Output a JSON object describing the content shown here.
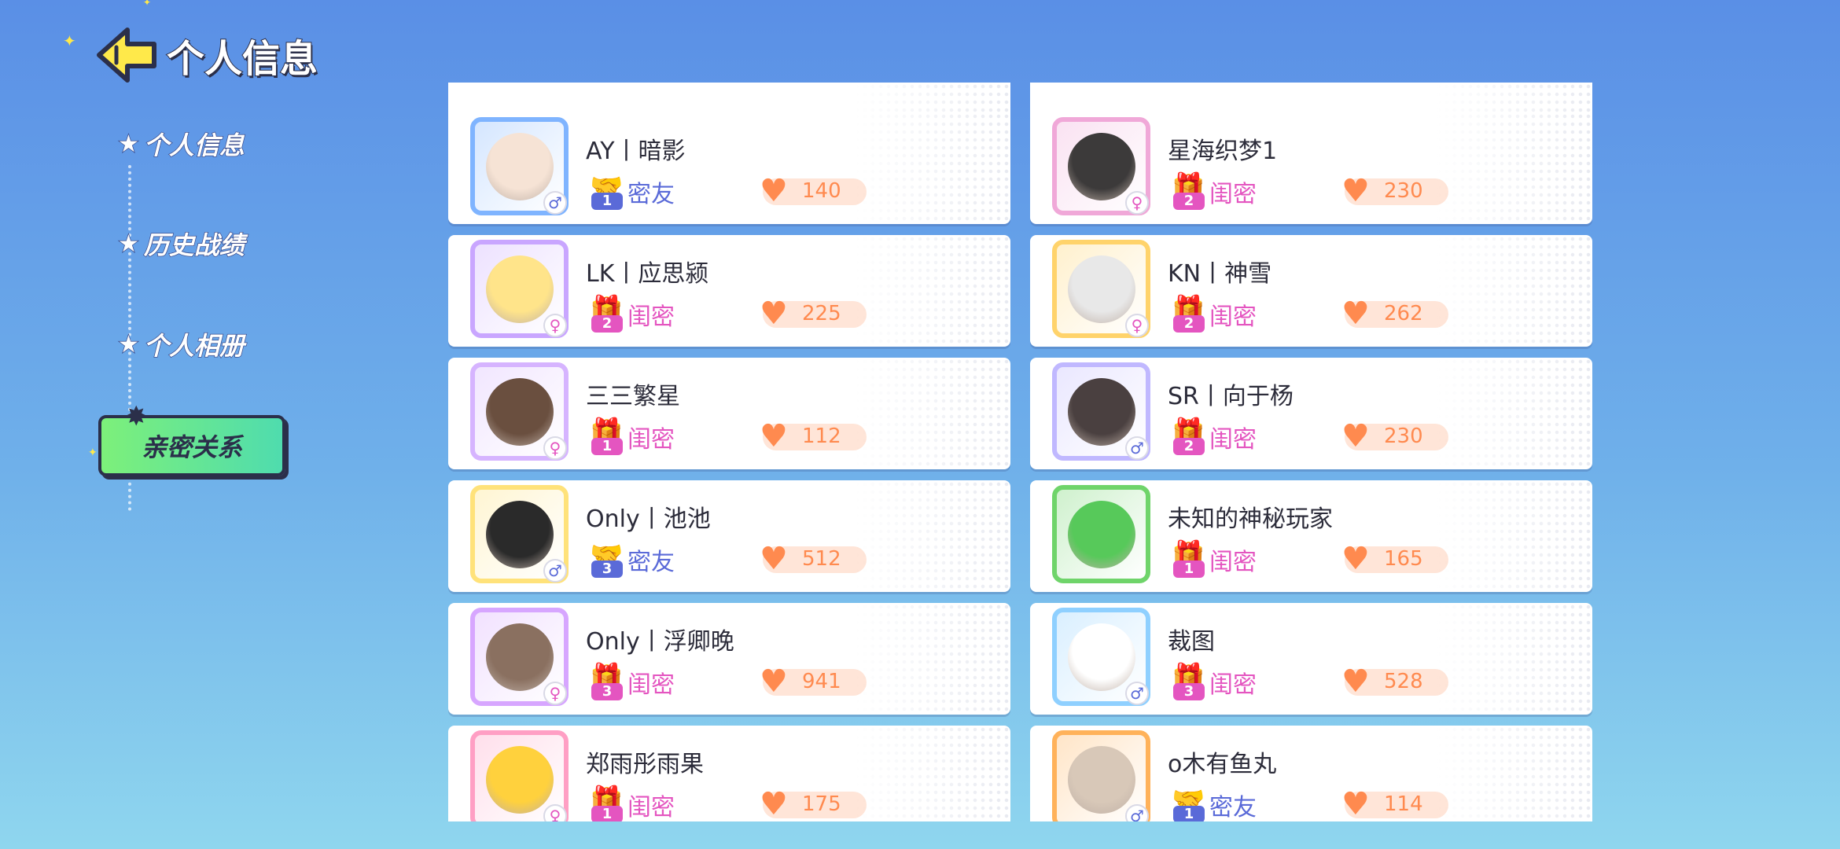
{
  "header": {
    "title": "个人信息"
  },
  "sidebar": {
    "items": [
      {
        "label": "个人信息"
      },
      {
        "label": "历史战绩"
      },
      {
        "label": "个人相册"
      },
      {
        "label": "亲密关系"
      }
    ]
  },
  "colors": {
    "mi_you": "#5a6ad8",
    "gui_mi": "#e455c0",
    "heart": "#ff8a4f",
    "active_tab": "#6ae88f"
  },
  "cards": [
    {
      "name": "AY丨暗影",
      "relation": "密友",
      "level": "1",
      "gender": "♂",
      "intimacy": "140"
    },
    {
      "name": "星海织梦1",
      "relation": "闺密",
      "level": "2",
      "gender": "♀",
      "intimacy": "230"
    },
    {
      "name": "LK丨应思颍",
      "relation": "闺密",
      "level": "2",
      "gender": "♀",
      "intimacy": "225"
    },
    {
      "name": "KN丨神雪",
      "relation": "闺密",
      "level": "2",
      "gender": "♀",
      "intimacy": "262"
    },
    {
      "name": "三三繁星",
      "relation": "闺密",
      "level": "1",
      "gender": "♀",
      "intimacy": "112"
    },
    {
      "name": "SR丨向于杨",
      "relation": "闺密",
      "level": "2",
      "gender": "♂",
      "intimacy": "230"
    },
    {
      "name": "Only丨池池",
      "relation": "密友",
      "level": "3",
      "gender": "♂",
      "intimacy": "512"
    },
    {
      "name": "未知的神秘玩家",
      "relation": "闺密",
      "level": "1",
      "gender": "",
      "intimacy": "165"
    },
    {
      "name": "Only丨浮卿晚",
      "relation": "闺密",
      "level": "3",
      "gender": "♀",
      "intimacy": "941"
    },
    {
      "name": "裁图",
      "relation": "闺密",
      "level": "3",
      "gender": "♂",
      "intimacy": "528"
    },
    {
      "name": "郑雨彤雨果",
      "relation": "闺密",
      "level": "1",
      "gender": "♀",
      "intimacy": "175"
    },
    {
      "name": "o木有鱼丸",
      "relation": "密友",
      "level": "1",
      "gender": "♂",
      "intimacy": "114"
    }
  ]
}
